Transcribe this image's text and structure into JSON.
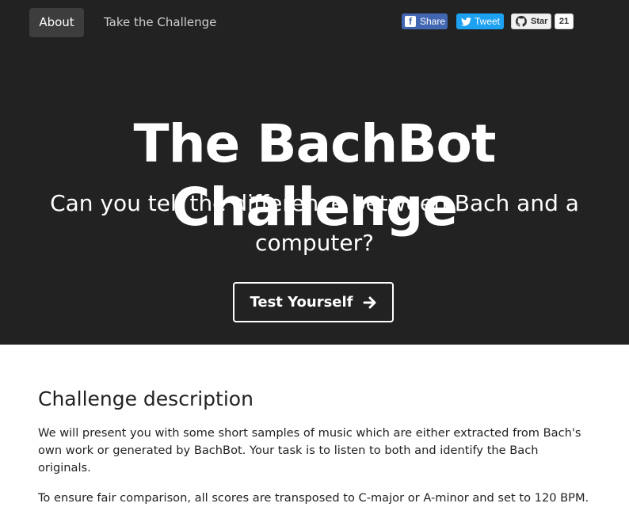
{
  "nav": {
    "about_label": "About",
    "challenge_label": "Take the Challenge"
  },
  "social": {
    "facebook_label": "Share",
    "twitter_label": "Tweet",
    "github_label": "Star",
    "github_count": "21",
    "colors": {
      "facebook": "#4267b2",
      "twitter": "#1da1f2"
    }
  },
  "hero": {
    "title": "The BachBot Challenge",
    "subtitle": "Can you tell the difference between Bach and a computer?",
    "cta_label": "Test Yourself",
    "cta_icon": "arrow-right-icon",
    "background": "#222222"
  },
  "content": {
    "heading": "Challenge description",
    "paragraph1": "We will present you with some short samples of music which are either extracted from Bach's own work or generated by BachBot. Your task is to listen to both and identify the Bach originals.",
    "paragraph2": "To ensure fair comparison, all scores are transposed to C-major or A-minor and set to 120 BPM."
  }
}
